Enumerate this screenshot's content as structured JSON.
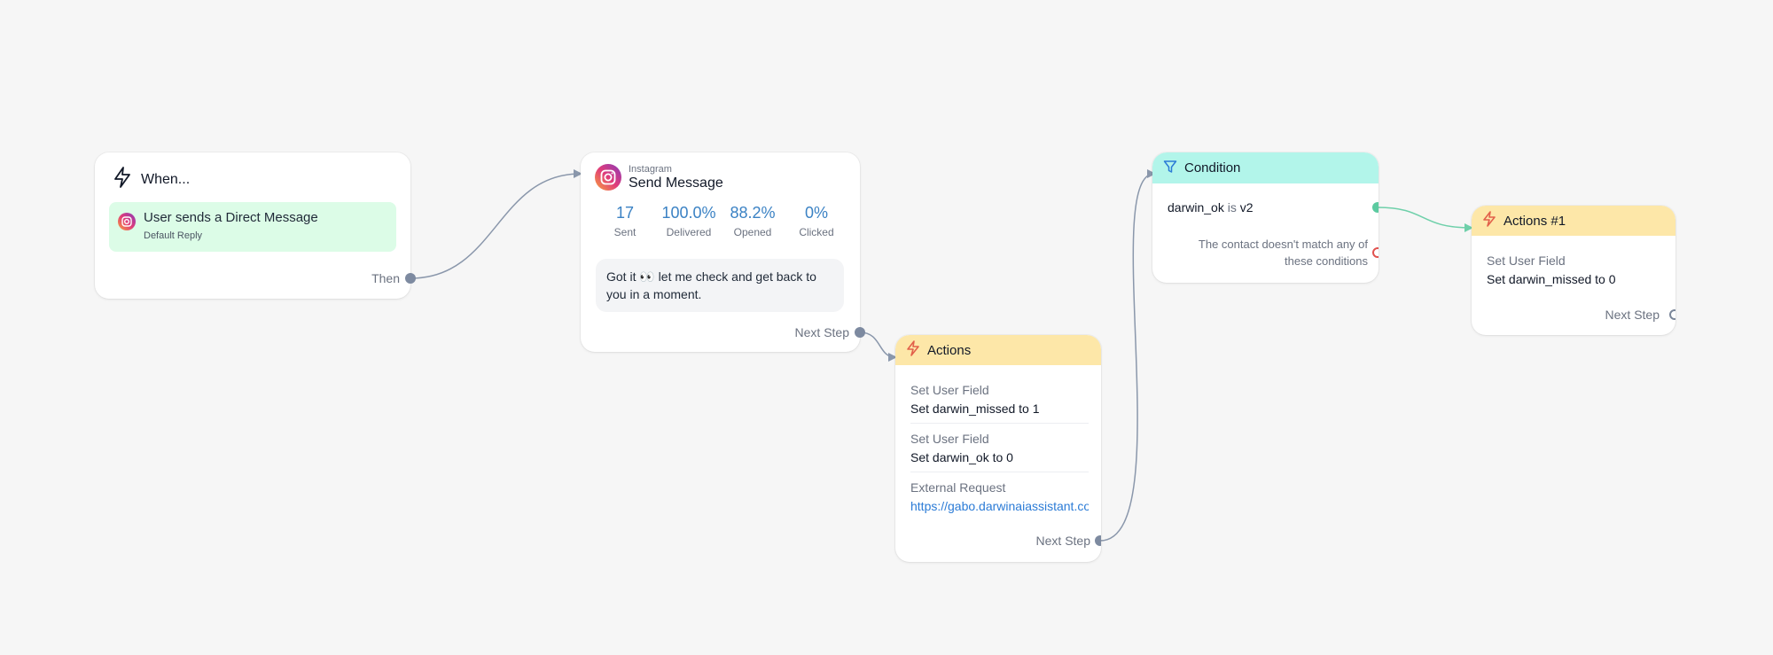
{
  "nodes": {
    "when": {
      "title": "When...",
      "trigger_title": "User sends a Direct Message",
      "trigger_subtitle": "Default Reply",
      "port_label": "Then"
    },
    "send_message": {
      "channel": "Instagram",
      "title": "Send Message",
      "stats": [
        {
          "value": "17",
          "label": "Sent"
        },
        {
          "value": "100.0%",
          "label": "Delivered"
        },
        {
          "value": "88.2%",
          "label": "Opened"
        },
        {
          "value": "0%",
          "label": "Clicked"
        }
      ],
      "message_before_emoji": "Got it",
      "message_emoji": "👀",
      "message_after_emoji": " let me check and get back to you in a moment.",
      "port_label": "Next Step"
    },
    "actions": {
      "title": "Actions",
      "items": [
        {
          "type": "Set User Field",
          "detail": "Set darwin_missed to 1"
        },
        {
          "type": "Set User Field",
          "detail": "Set darwin_ok to 0"
        },
        {
          "type": "External Request",
          "detail": "https://gabo.darwinaiassistant.co"
        }
      ],
      "port_label": "Next Step"
    },
    "condition": {
      "title": "Condition",
      "field": "darwin_ok",
      "operator": "is",
      "value": "v2",
      "else_text": "The contact doesn't match any of these conditions"
    },
    "actions1": {
      "title": "Actions #1",
      "items": [
        {
          "type": "Set User Field",
          "detail": "Set darwin_missed to 0"
        }
      ],
      "port_label": "Next Step"
    }
  },
  "colors": {
    "canvas": "#f6f6f6",
    "trigger_bg": "#dcfce7",
    "action_header": "#fde7a8",
    "condition_header": "#b2f5ea",
    "stat_blue": "#3b82c4",
    "edge": "#8a97ab",
    "edge_green": "#6fd0aa",
    "link": "#2b7bd6"
  },
  "icons": {
    "trigger": "lightning-icon",
    "channel": "instagram-icon",
    "action": "lightning-icon",
    "condition": "filter-icon"
  }
}
